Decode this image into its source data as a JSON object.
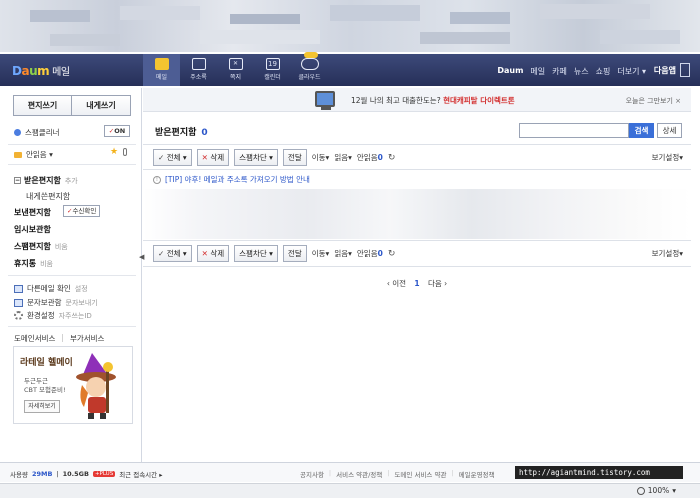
{
  "header": {
    "logo_daum": [
      "D",
      "a",
      "u",
      "m"
    ],
    "logo_mail": "메일",
    "nav": [
      {
        "label": "메일",
        "icon": "envelope-icon"
      },
      {
        "label": "주소록",
        "icon": "address-book-icon"
      },
      {
        "label": "쪽지",
        "icon": "note-icon"
      },
      {
        "label": "캘린더",
        "icon": "calendar-icon",
        "day": "19"
      },
      {
        "label": "클라우드",
        "icon": "cloud-icon",
        "badge": "50GB"
      }
    ],
    "topmenu": [
      "Daum",
      "메일",
      "카페",
      "뉴스",
      "쇼핑",
      "더보기 ▾"
    ],
    "user": "다음앱"
  },
  "left": {
    "compose": "편지쓰기",
    "self_compose": "내게쓰기",
    "spam_cleaner": "스팸클리너",
    "on_label": "ON",
    "unread": "안읽음 ▾",
    "inbox": "받은편지함",
    "add": "추가",
    "to_me": "내게쓴편지함",
    "sent": "보낸편지함",
    "receipt": "수신확인",
    "drafts": "임시보관함",
    "spam": "스팸편지함",
    "empty1": "비움",
    "trash": "휴지통",
    "empty2": "비움",
    "other_mail": "다른메일 확인",
    "other_mail_sub": "설정",
    "sms": "문자보관함",
    "sms_sub": "문자보내기",
    "settings": "환경설정",
    "settings_sub": "자주쓰는ID",
    "svc_domain": "도메인서비스",
    "svc_addon": "부가서비스",
    "ad_title": "라테일 헬메이",
    "ad_sub1": "두근두근",
    "ad_sub2": "CBT 모험준비!",
    "ad_btn": "자세히보기"
  },
  "main": {
    "banner_text": "12월 나의 최고 대출한도는?",
    "banner_brand": "현대캐피탈 다이렉트론",
    "banner_right": "오늘은 그만보기 ×",
    "title": "받은편지함",
    "count": "0",
    "search_placeholder": "",
    "search_btn": "검색",
    "detail_btn": "상세",
    "toolbar": {
      "all": "전체",
      "delete": "삭제",
      "spam_block": "스팸차단",
      "forward": "전달",
      "move": "이동▾",
      "read": "읽음▾",
      "unread": "안읽음",
      "unread_count": "0",
      "view_settings": "보기설정▾"
    },
    "tip": "[TIP] 야후! 메일과 주소록 가져오기 방법 안내",
    "pager": {
      "prev": "‹ 이전",
      "current": "1",
      "next": "다음 ›"
    }
  },
  "footer": {
    "usage_label": "사용량",
    "usage_value": "29MB",
    "capacity": "10.5GB",
    "plus": "+PLUS",
    "last_login": "최근 접속시간 ▸",
    "links": [
      "공지사항",
      "서비스 약관/정책",
      "도메인 서비스 약관",
      "메일운영정책"
    ],
    "url": "http://agiantmind.tistory.com"
  },
  "statusbar": {
    "zoom": "100%"
  }
}
